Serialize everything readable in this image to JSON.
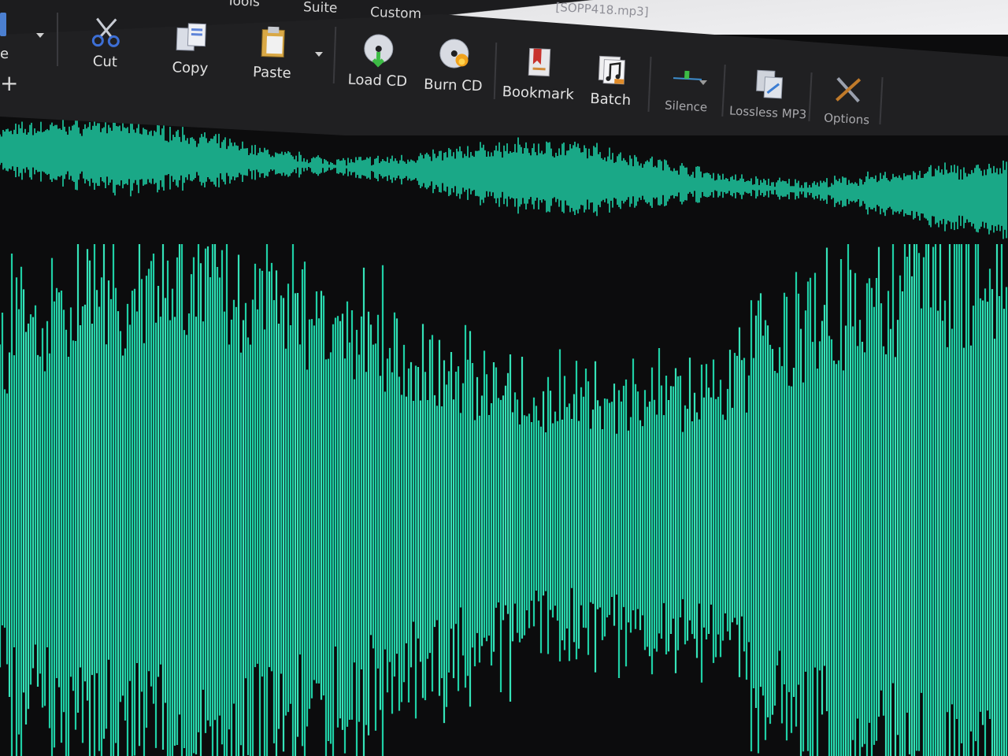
{
  "window": {
    "title": "[SOPP418.mp3]"
  },
  "menu": {
    "items": [
      "Tools",
      "Suite",
      "Custom"
    ]
  },
  "toolbar": {
    "left_edge_label": "e",
    "buttons": [
      {
        "label": "Cut",
        "icon": "scissors-icon"
      },
      {
        "label": "Copy",
        "icon": "copy-icon"
      },
      {
        "label": "Paste",
        "icon": "paste-clipboard-icon"
      },
      {
        "label": "Load CD",
        "icon": "load-cd-icon"
      },
      {
        "label": "Burn CD",
        "icon": "burn-cd-icon"
      },
      {
        "label": "Bookmark",
        "icon": "bookmark-icon"
      },
      {
        "label": "Batch",
        "icon": "batch-music-icon"
      },
      {
        "label": "Silence",
        "icon": "silence-icon"
      },
      {
        "label": "Lossless MP3",
        "icon": "lossless-mp3-icon"
      },
      {
        "label": "Options",
        "icon": "tools-options-icon"
      }
    ]
  },
  "colors": {
    "waveform": "#1fd0a6",
    "waveform_bright": "#35e3b8",
    "background": "#0c0c0d",
    "toolbar": "#202022"
  }
}
